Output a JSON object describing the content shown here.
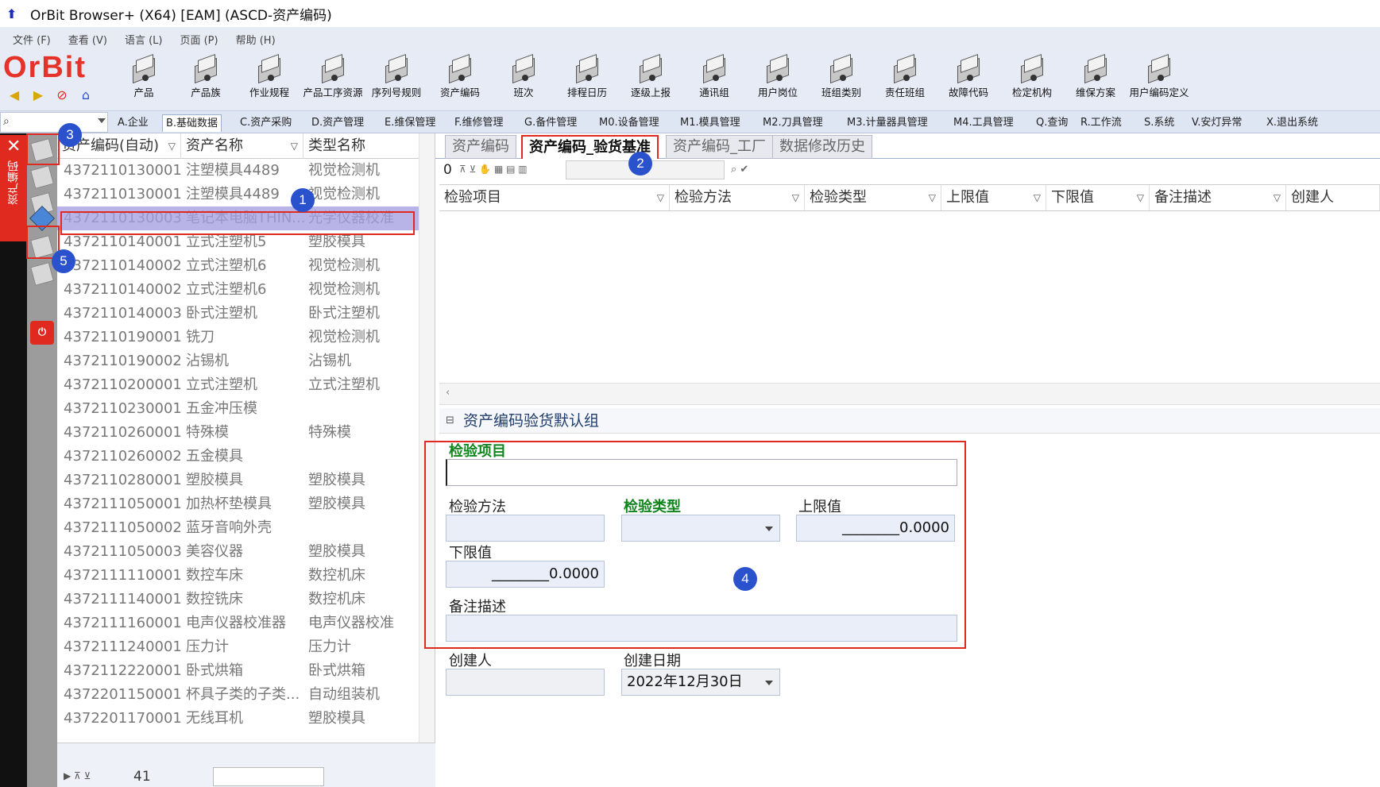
{
  "window": {
    "title": "OrBit Browser+ (X64) [EAM] (ASCD-资产编码)"
  },
  "menu": [
    "文件 (F)",
    "查看 (V)",
    "语言 (L)",
    "页面 (P)",
    "帮助 (H)"
  ],
  "brand": {
    "name": "OrBit",
    "color": "#e63329"
  },
  "toolbar": [
    {
      "label": "产品",
      "icon": "product-icon"
    },
    {
      "label": "产品族",
      "icon": "product-family-icon"
    },
    {
      "label": "作业规程",
      "icon": "gear-icon"
    },
    {
      "label": "产品工序资源",
      "icon": "process-resource-icon"
    },
    {
      "label": "序列号规则",
      "icon": "serial-rule-icon"
    },
    {
      "label": "资产编码",
      "icon": "asset-code-icon"
    },
    {
      "label": "班次",
      "icon": "shift-icon"
    },
    {
      "label": "排程日历",
      "icon": "calendar-icon"
    },
    {
      "label": "逐级上报",
      "icon": "escalation-icon"
    },
    {
      "label": "通讯组",
      "icon": "comm-group-icon"
    },
    {
      "label": "用户岗位",
      "icon": "user-post-icon"
    },
    {
      "label": "班组类别",
      "icon": "team-type-icon"
    },
    {
      "label": "责任班组",
      "icon": "team-icon"
    },
    {
      "label": "故障代码",
      "icon": "fault-code-icon"
    },
    {
      "label": "检定机构",
      "icon": "user-icon"
    },
    {
      "label": "维保方案",
      "icon": "maintenance-plan-icon"
    },
    {
      "label": "用户编码定义",
      "icon": "books-icon"
    }
  ],
  "module_tabs": [
    "A.企业",
    "B.基础数据",
    "C.资产采购",
    "D.资产管理",
    "E.维保管理",
    "F.维修管理",
    "G.备件管理",
    "M0.设备管理",
    "M1.模具管理",
    "M2.刀具管理",
    "M3.计量器具管理",
    "M4.工具管理",
    "Q.查询",
    "R.工作流",
    "S.系统",
    "V.安灯异常",
    "X.退出系统"
  ],
  "side_tab": {
    "label": "资产编码"
  },
  "left_grid": {
    "columns": [
      "资产编码(自动)",
      "资产名称",
      "类型名称"
    ],
    "rows": [
      [
        "4372110130001",
        "注塑模具4489",
        "视觉检测机"
      ],
      [
        "4372110130001",
        "注塑模具4489",
        "视觉检测机"
      ],
      [
        "4372110130003",
        "笔记本电脑THIN...",
        "光学仪器校准"
      ],
      [
        "4372110140001",
        "立式注塑机5",
        "塑胶模具"
      ],
      [
        "4372110140002",
        "立式注塑机6",
        "视觉检测机"
      ],
      [
        "4372110140002",
        "立式注塑机6",
        "视觉检测机"
      ],
      [
        "4372110140003",
        "卧式注塑机",
        "卧式注塑机"
      ],
      [
        "4372110190001",
        "铣刀",
        "视觉检测机"
      ],
      [
        "4372110190002",
        "沾锡机",
        "沾锡机"
      ],
      [
        "4372110200001",
        "立式注塑机",
        "立式注塑机"
      ],
      [
        "4372110230001",
        "五金冲压模",
        ""
      ],
      [
        "4372110260001",
        "特殊模",
        "特殊模"
      ],
      [
        "4372110260002",
        "五金模具",
        ""
      ],
      [
        "4372110280001",
        "塑胶模具",
        "塑胶模具"
      ],
      [
        "4372111050001",
        "加热杯垫模具",
        "塑胶模具"
      ],
      [
        "4372111050002",
        "蓝牙音响外壳",
        ""
      ],
      [
        "4372111050003",
        "美容仪器",
        "塑胶模具"
      ],
      [
        "4372111110001",
        "数控车床",
        "数控机床"
      ],
      [
        "4372111140001",
        "数控铣床",
        "数控机床"
      ],
      [
        "4372111160001",
        "电声仪器校准器",
        "电声仪器校准"
      ],
      [
        "4372111240001",
        "压力计",
        "压力计"
      ],
      [
        "4372112220001",
        "卧式烘箱",
        "卧式烘箱"
      ],
      [
        "4372201150001",
        "杯具子类的子类...",
        "自动组装机"
      ],
      [
        "4372201170001",
        "无线耳机",
        "塑胶模具"
      ]
    ],
    "record_count": "41"
  },
  "right_tabs": [
    "资产编码",
    "资产编码_验货基准",
    "资产编码_工厂",
    "数据修改历史"
  ],
  "sub_toolbar": {
    "count": "0"
  },
  "right_grid": {
    "columns": [
      "检验项目",
      "检验方法",
      "检验类型",
      "上限值",
      "下限值",
      "备注描述",
      "创建人"
    ]
  },
  "form": {
    "group_title": "资产编码验货默认组",
    "inspect_item_label": "检验项目",
    "inspect_method_label": "检验方法",
    "inspect_type_label": "检验类型",
    "upper_label": "上限值",
    "upper_value": "________0.0000",
    "lower_label": "下限值",
    "lower_value": "________0.0000",
    "remark_label": "备注描述",
    "creator_label": "创建人",
    "created_date_label": "创建日期",
    "created_date_value": "2022年12月30日"
  },
  "annotations": [
    "1",
    "2",
    "3",
    "4",
    "5"
  ]
}
